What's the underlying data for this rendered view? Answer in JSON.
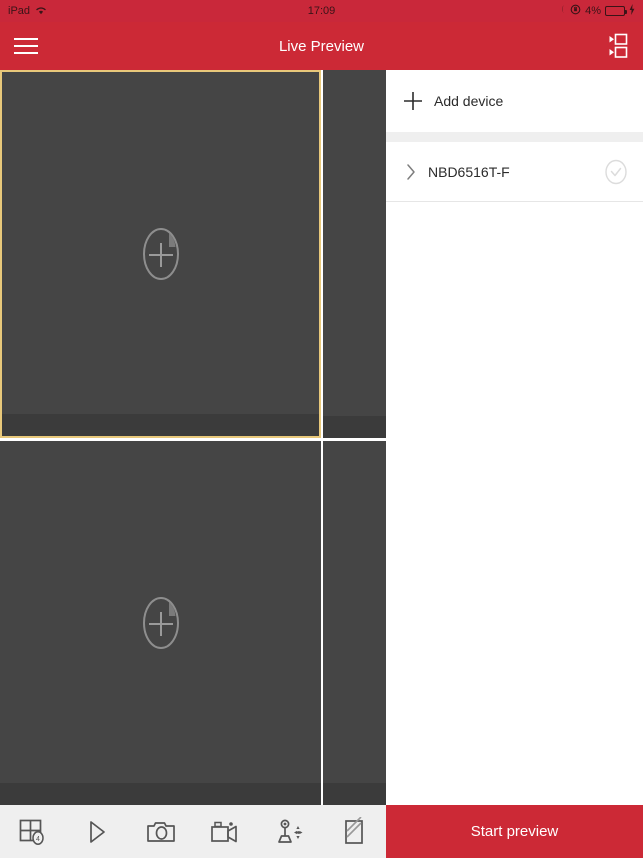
{
  "statusbar": {
    "device": "iPad",
    "wifi_icon": "wifi-icon",
    "time": "17:09",
    "moon_icon": "moon-do-not-disturb-icon",
    "rotation_lock_icon": "rotation-lock-icon",
    "battery_percent": "4%",
    "battery_icon": "battery-icon",
    "charging_icon": "lightning-bolt-icon"
  },
  "header": {
    "menu_icon": "hamburger-menu-icon",
    "title": "Live Preview",
    "layout_icon": "channel-layout-icon"
  },
  "video": {
    "placeholder_icon": "add-channel-icon",
    "cells": [
      {
        "name": "channel-1",
        "selected": true,
        "placeholder": true
      },
      {
        "name": "channel-2",
        "selected": false,
        "placeholder": false
      },
      {
        "name": "channel-3",
        "selected": false,
        "placeholder": true
      },
      {
        "name": "channel-4",
        "selected": false,
        "placeholder": false
      }
    ],
    "selection_color": "#e8c87a",
    "cell_bg": "#454545"
  },
  "toolbar": {
    "items": [
      {
        "name": "split-layout-button",
        "icon": "grid-layout-icon"
      },
      {
        "name": "play-button",
        "icon": "play-icon"
      },
      {
        "name": "snapshot-button",
        "icon": "camera-icon"
      },
      {
        "name": "record-button",
        "icon": "video-camera-icon"
      },
      {
        "name": "ptz-button",
        "icon": "ptz-joystick-icon"
      },
      {
        "name": "more-button",
        "icon": "fisheye-icon"
      }
    ]
  },
  "sidebar": {
    "add_device": {
      "label": "Add device",
      "icon": "plus-icon"
    },
    "devices": [
      {
        "name": "NBD6516T-F",
        "chevron_icon": "chevron-right-icon",
        "status_icon": "circle-check-icon"
      }
    ],
    "start_preview_label": "Start preview"
  },
  "colors": {
    "brand_red": "#cc2936",
    "panel_dark": "#454545",
    "selection_yellow": "#e8c87a",
    "toolbar_bg": "#efefef"
  }
}
